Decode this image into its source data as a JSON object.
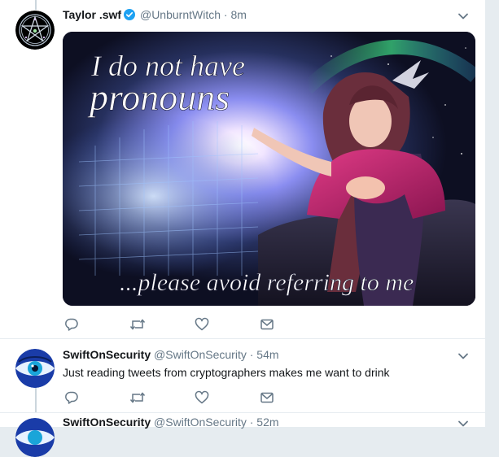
{
  "tweets": [
    {
      "name": "Taylor .swf",
      "handle": "@UnburntWitch",
      "separator": "·",
      "time": "8m",
      "verified": true,
      "media_text": {
        "line1": "I do not have",
        "line2": "pronouns",
        "line3": "...please avoid referring to me"
      }
    },
    {
      "name": "SwiftOnSecurity",
      "handle": "@SwiftOnSecurity",
      "separator": "·",
      "time": "54m",
      "text": "Just reading tweets from cryptographers makes me want to drink"
    },
    {
      "name": "SwiftOnSecurity",
      "handle": "@SwiftOnSecurity",
      "separator": "·",
      "time": "52m"
    }
  ],
  "icons": {
    "reply": "reply-icon",
    "retweet": "retweet-icon",
    "like": "heart-icon",
    "dm": "envelope-icon",
    "caret": "chevron-down-icon"
  },
  "colors": {
    "verified": "#1da1f2",
    "icon_gray": "#657786",
    "thread_line": "#ccd6dd",
    "background": "#e6ecf0"
  }
}
